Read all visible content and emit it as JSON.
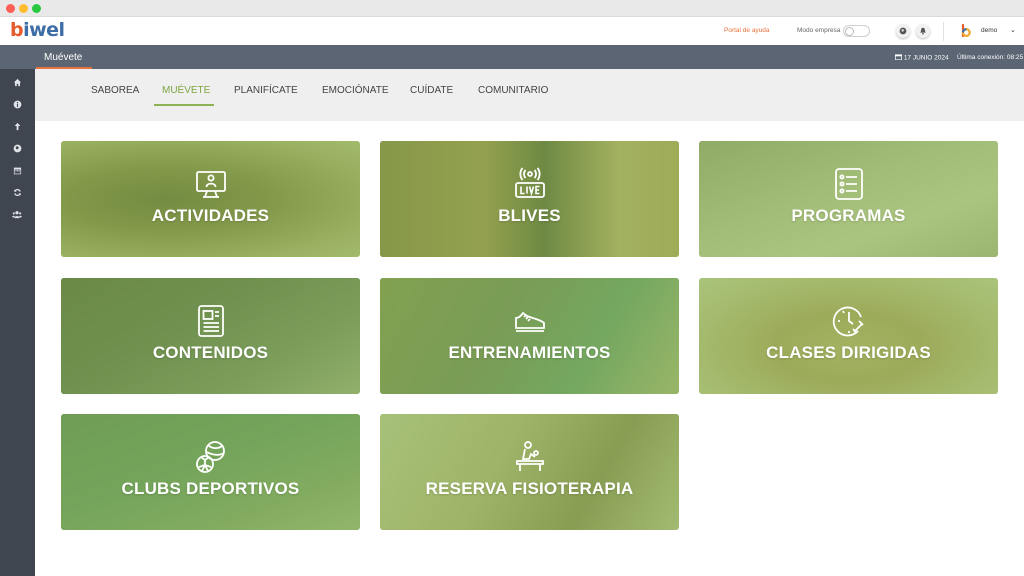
{
  "brand": {
    "logo_b": "b",
    "logo_rest": "iwel"
  },
  "header": {
    "help_link": "Portal de ayuda",
    "company_mode_label": "Modo empresa",
    "user_name": "demo"
  },
  "section": {
    "title": "Muévete",
    "date": "17 JUNIO 2024",
    "last_connection": "Última conexión: 08:25"
  },
  "sidebar": {
    "items": [
      {
        "icon": "home-icon"
      },
      {
        "icon": "info-icon"
      },
      {
        "icon": "upload-icon"
      },
      {
        "icon": "globe-icon"
      },
      {
        "icon": "calendar-icon"
      },
      {
        "icon": "refresh-icon"
      },
      {
        "icon": "users-icon"
      }
    ]
  },
  "tabs": [
    {
      "label": "SABOREA",
      "active": false
    },
    {
      "label": "MUÉVETE",
      "active": true
    },
    {
      "label": "PLANIFÍCATE",
      "active": false
    },
    {
      "label": "EMOCIÓNATE",
      "active": false
    },
    {
      "label": "CUÍDATE",
      "active": false
    },
    {
      "label": "COMUNITARIO",
      "active": false
    }
  ],
  "tiles": [
    {
      "label": "ACTIVIDADES",
      "icon": "monitor-person-icon"
    },
    {
      "label": "BLIVES",
      "icon": "live-broadcast-icon"
    },
    {
      "label": "PROGRAMAS",
      "icon": "list-icon"
    },
    {
      "label": "CONTENIDOS",
      "icon": "document-icon"
    },
    {
      "label": "ENTRENAMIENTOS",
      "icon": "sneaker-icon"
    },
    {
      "label": "CLASES DIRIGIDAS",
      "icon": "clock-dumbbell-icon"
    },
    {
      "label": "CLUBS DEPORTIVOS",
      "icon": "balls-icon"
    },
    {
      "label": "RESERVA FISIOTERAPIA",
      "icon": "physiotherapy-icon"
    }
  ],
  "colors": {
    "accent_green": "#8db255",
    "accent_orange": "#e8733c",
    "section_bar": "#5c6573",
    "sidebar": "#3f4650"
  }
}
